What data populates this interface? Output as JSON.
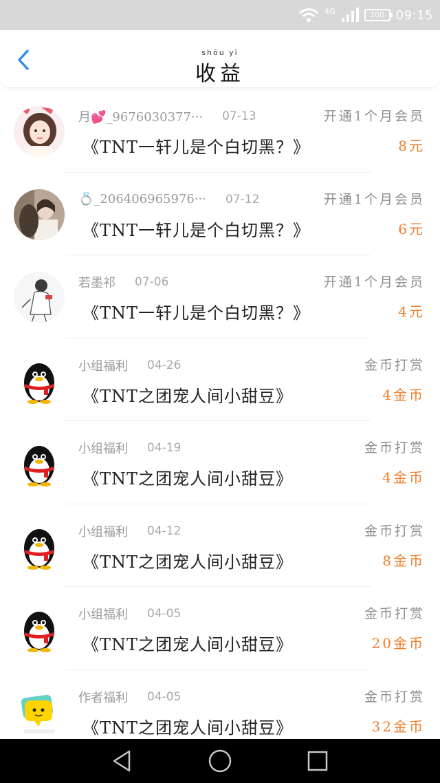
{
  "status_bar": {
    "network": "4G",
    "battery": "100",
    "time": "09:15"
  },
  "header": {
    "title": "收益",
    "title_pinyin": "shōu  yì"
  },
  "icons": {
    "back": "chevron-left-icon",
    "wifi": "wifi-icon",
    "signal": "signal-icon",
    "battery": "battery-icon",
    "nav_back": "triangle-back-icon",
    "nav_home": "circle-home-icon",
    "nav_recent": "square-recent-icon"
  },
  "colors": {
    "accent": "#f07e2a",
    "back_arrow": "#2f8fe8",
    "meta_text": "#9a9a9a"
  },
  "records": [
    {
      "avatar": "girl-illustration-avatar",
      "name": "月💕_9676030377···",
      "date": "07-13",
      "work": "《TNT一轩儿是个白切黑？》",
      "reward_type": "开通1个月会员",
      "amount": "8元"
    },
    {
      "avatar": "couple-photo-avatar",
      "name": "💍_206406965976···",
      "date": "07-12",
      "work": "《TNT一轩儿是个白切黑？》",
      "reward_type": "开通1个月会员",
      "amount": "6元"
    },
    {
      "avatar": "sketch-girl-avatar",
      "name": "若墨祁",
      "date": "07-06",
      "work": "《TNT一轩儿是个白切黑？》",
      "reward_type": "开通1个月会员",
      "amount": "4元"
    },
    {
      "avatar": "penguin-avatar",
      "name": "小组福利",
      "date": "04-26",
      "work": "《TNT之团宠人间小甜豆》",
      "reward_type": "金币打赏",
      "amount": "4金币"
    },
    {
      "avatar": "penguin-avatar",
      "name": "小组福利",
      "date": "04-19",
      "work": "《TNT之团宠人间小甜豆》",
      "reward_type": "金币打赏",
      "amount": "4金币"
    },
    {
      "avatar": "penguin-avatar",
      "name": "小组福利",
      "date": "04-12",
      "work": "《TNT之团宠人间小甜豆》",
      "reward_type": "金币打赏",
      "amount": "8金币"
    },
    {
      "avatar": "penguin-avatar",
      "name": "小组福利",
      "date": "04-05",
      "work": "《TNT之团宠人间小甜豆》",
      "reward_type": "金币打赏",
      "amount": "20金币"
    },
    {
      "avatar": "chat-bubble-avatar",
      "name": "作者福利",
      "date": "04-05",
      "work": "《TNT之团宠人间小甜豆》",
      "reward_type": "金币打赏",
      "amount": "32金币"
    }
  ]
}
